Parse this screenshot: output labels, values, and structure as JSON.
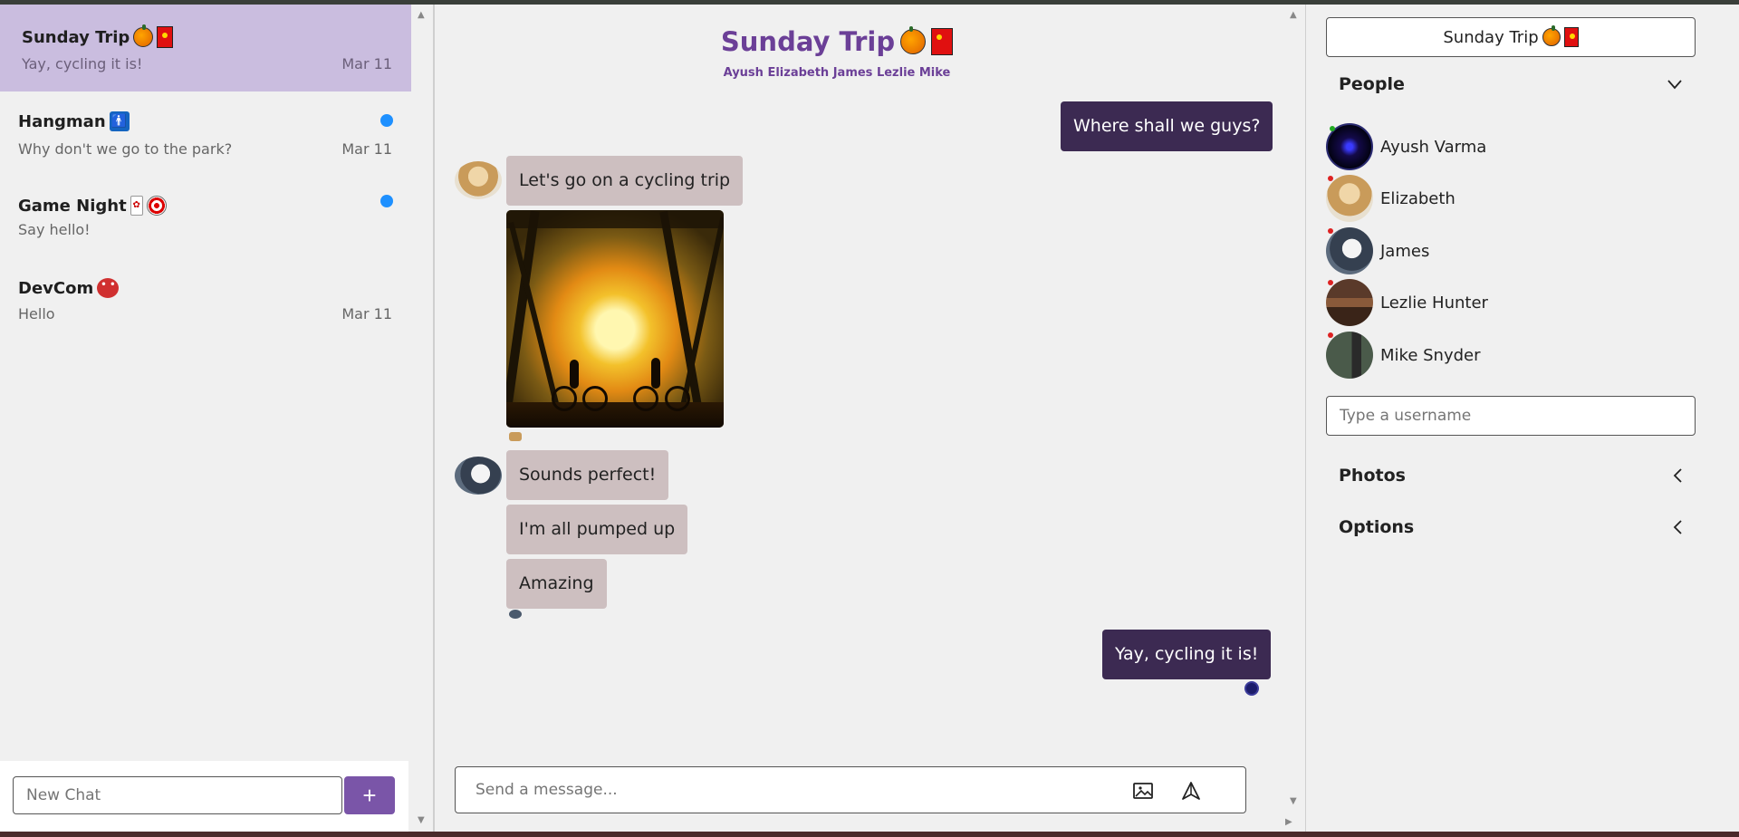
{
  "chats": [
    {
      "title": "Sunday Trip",
      "preview": "Yay, cycling it is!",
      "date": "Mar 11",
      "active": true,
      "unread": false,
      "emoji": [
        "pumpkin",
        "red-envelope"
      ]
    },
    {
      "title": "Hangman",
      "preview": "Why don't we go to the park?",
      "date": "Mar 11",
      "active": false,
      "unread": true,
      "emoji": [
        "restroom"
      ]
    },
    {
      "title": "Game Night",
      "preview": "Say hello!",
      "date": "",
      "active": false,
      "unread": true,
      "emoji": [
        "flower-card",
        "direct-hit"
      ]
    },
    {
      "title": "DevCom",
      "preview": "Hello",
      "date": "Mar 11",
      "active": false,
      "unread": false,
      "emoji": [
        "devil"
      ]
    }
  ],
  "new_chat": {
    "placeholder": "New Chat",
    "button": "+"
  },
  "conversation": {
    "title": "Sunday Trip",
    "members": "Ayush Elizabeth James Lezlie Mike",
    "messages": {
      "m1": "Where shall we guys?",
      "m2": "Let's go on a cycling trip",
      "m3": "Sounds perfect!",
      "m4": "I'm all pumped up",
      "m5": "Amazing",
      "m6": "Yay, cycling it is!"
    },
    "input_placeholder": "Send a message..."
  },
  "details": {
    "title": "Sunday Trip",
    "people_label": "People",
    "people": [
      {
        "name": "Ayush Varma",
        "status_color": "#22aa22"
      },
      {
        "name": "Elizabeth",
        "status_color": "#dd2222"
      },
      {
        "name": "James",
        "status_color": "#dd2222"
      },
      {
        "name": "Lezlie Hunter",
        "status_color": "#dd2222"
      },
      {
        "name": "Mike Snyder",
        "status_color": "#dd2222"
      }
    ],
    "username_placeholder": "Type a username",
    "photos_label": "Photos",
    "options_label": "Options"
  },
  "colors": {
    "accent": "#7a55a8",
    "active_chat": "#cabddf",
    "my_bubble": "#3c2a52",
    "their_bubble": "#cdbfc0",
    "unread_dot": "#1e90ff"
  },
  "icons": {
    "image": "image-icon",
    "send": "send-icon",
    "expanded": "chevron-down-icon",
    "collapsed": "chevron-left-icon"
  }
}
